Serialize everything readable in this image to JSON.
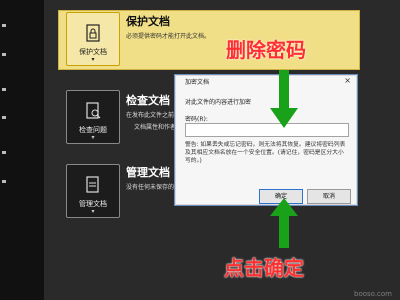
{
  "left_nav": {
    "ticks": [
      24,
      53,
      88,
      116,
      151,
      180
    ]
  },
  "protect": {
    "card_label": "保护文档",
    "card_dropdown": "▾",
    "title": "保护文档",
    "subtitle": "必须提供密码才能打开此文档。",
    "icon": "lock-document-icon"
  },
  "inspect": {
    "card_label": "检查问题",
    "card_dropdown": "▾",
    "title": "检查文档",
    "sub1": "在发布此文件之前，请注意其是否包含:",
    "sub2": "文档属性和作者的姓名",
    "icon": "inspect-document-icon"
  },
  "manage": {
    "card_label": "管理文档",
    "card_dropdown": "▾",
    "title": "管理文档",
    "sub1": "没有任何未保存的更改。",
    "icon": "manage-document-icon"
  },
  "dialog": {
    "title": "加密文档",
    "close": "×",
    "instruction": "对此文件的内容进行加密",
    "password_label": "密码(R):",
    "password_value": "",
    "warning": "警告: 如果丢失或忘记密码，则无法将其恢复。建议将密码列表及其相应文档名放在一个安全位置。(请记住，密码是区分大小写的。)",
    "ok_label": "确定",
    "cancel_label": "取消"
  },
  "annotations": {
    "top_label": "删除密码",
    "bottom_label": "点击确定",
    "top_label_color": "#ff2f2f",
    "arrow_color": "#1aa11a"
  },
  "watermark": "booso.com"
}
